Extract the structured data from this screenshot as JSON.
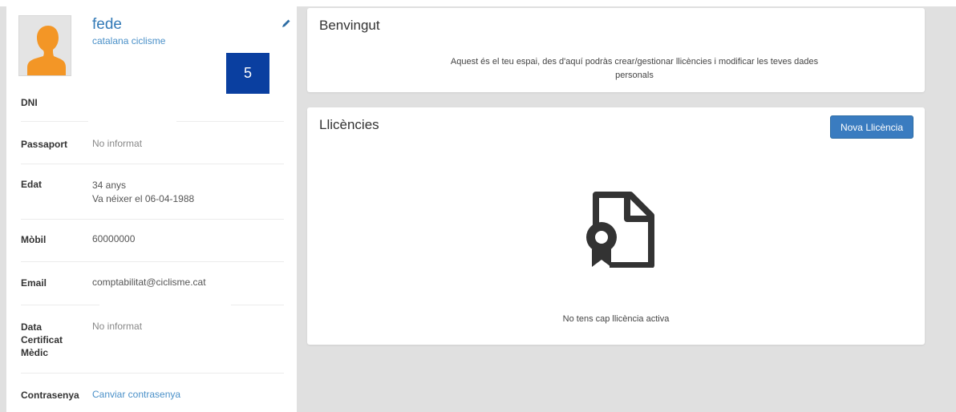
{
  "profile": {
    "name": "fede",
    "club": "catalana ciclisme",
    "badge": "5",
    "rows": [
      {
        "label": "DNI",
        "value": ""
      },
      {
        "label": "Passaport",
        "value": "No informat"
      },
      {
        "label": "Edat",
        "value": "34 anys",
        "value2": "Va néixer el 06-04-1988"
      },
      {
        "label": "Mòbil",
        "value": "60000000"
      },
      {
        "label": "Email",
        "value": "comptabilitat@ciclisme.cat"
      },
      {
        "label": "Data Certificat Mèdic",
        "label_lines": [
          "Data",
          "Certificat",
          "Mèdic"
        ],
        "value": "No informat"
      },
      {
        "label": "Contrasenya",
        "value": "Canviar contrasenya"
      }
    ]
  },
  "welcome": {
    "title": "Benvingut",
    "line1": "Aquest és el teu espai, des d'aquí podràs crear/gestionar llicències i modificar les teves dades",
    "line2": "personals"
  },
  "licenses": {
    "title": "Llicències",
    "new_button": "Nova Llicència",
    "empty_message": "No tens cap llicència activa",
    "icon": "license-certificate-icon"
  },
  "icons": {
    "edit": "pencil-icon",
    "avatar": "user-silhouette-icon"
  },
  "colors": {
    "accent": "#337ab7",
    "button": "#3a7cc0",
    "badge": "#0a3fa0",
    "background": "#e0e0e0"
  }
}
